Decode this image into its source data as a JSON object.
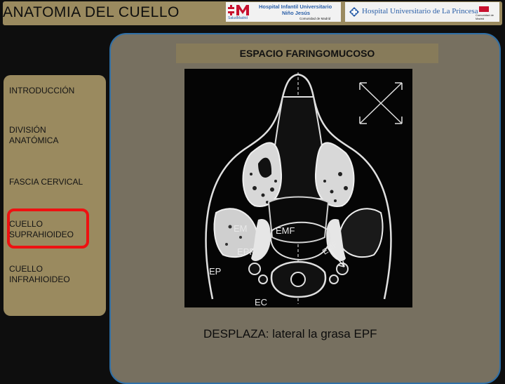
{
  "header": {
    "title": "ANATOMIA DEL CUELLO",
    "logo_left": {
      "line1": "Hospital Infantil Universitario",
      "line2": "Niño Jesús",
      "sub_left": "SaludMadrid",
      "sub_right": "Comunidad de Madrid"
    },
    "logo_right": {
      "name": "Hospital Universitario de La Princesa",
      "flag_text": "Comunidad de Madrid"
    }
  },
  "sidebar": {
    "items": [
      {
        "label": "INTRODUCCIÓN"
      },
      {
        "label": "DIVISIÓN\nANATÓMICA"
      },
      {
        "label": "FASCIA CERVICAL"
      },
      {
        "label": "CUELLO\nSUPRAHIOIDEO"
      },
      {
        "label": "CUELLO\nINFRAHIOIDEO"
      }
    ],
    "selected": "CUELLO SUPRAHIOIDEO",
    "highlight_color": "#ee1111"
  },
  "main": {
    "section_title": "ESPACIO FARINGOMUCOSO",
    "caption": "DESPLAZA: lateral la grasa EPF",
    "figure_labels": [
      "EM",
      "EMF",
      "EPF",
      "EMF",
      "EP",
      "EC"
    ]
  },
  "colors": {
    "accent": "#9a8a5f",
    "panel": "#777060",
    "panel_border": "#2f6fa6",
    "background": "#0e0e0e"
  }
}
